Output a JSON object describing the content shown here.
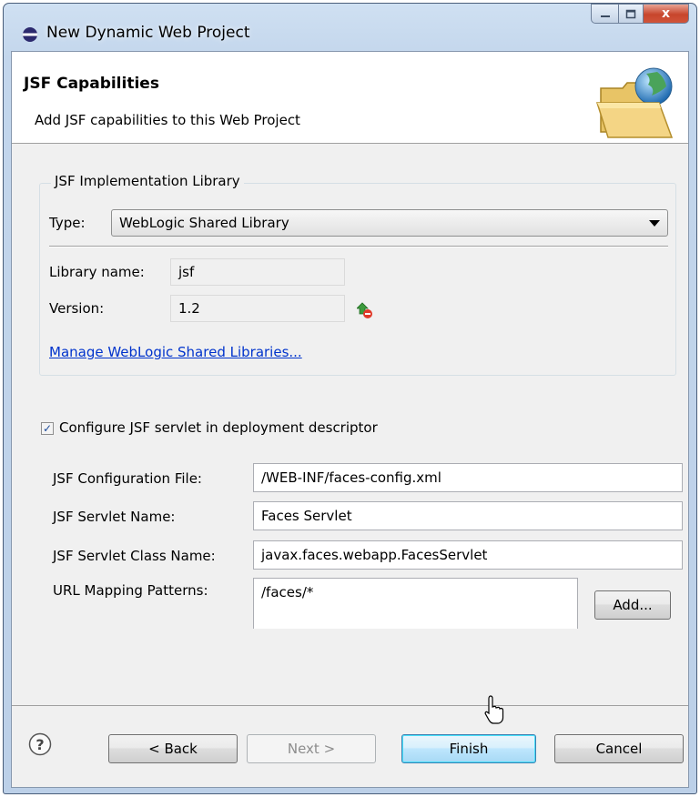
{
  "window": {
    "title": "New Dynamic Web Project",
    "close_glyph": "x"
  },
  "header": {
    "title": "JSF Capabilities",
    "description": "Add JSF capabilities to this Web Project",
    "icon": "folder-globe-icon"
  },
  "library_group": {
    "legend": "JSF Implementation Library",
    "type_label": "Type:",
    "type_value": "WebLogic Shared Library",
    "library_name_label": "Library name:",
    "library_name_value": "jsf",
    "version_label": "Version:",
    "version_value": "1.2",
    "manage_link": "Manage WebLogic Shared Libraries..."
  },
  "servlet": {
    "checkbox_label": "Configure JSF servlet in deployment descriptor",
    "checked": true,
    "config_file_label": "JSF Configuration File:",
    "config_file_value": "/WEB-INF/faces-config.xml",
    "servlet_name_label": "JSF Servlet Name:",
    "servlet_name_value": "Faces Servlet",
    "servlet_class_label": "JSF Servlet Class Name:",
    "servlet_class_value": "javax.faces.webapp.FacesServlet",
    "url_patterns_label": "URL Mapping Patterns:",
    "url_patterns": [
      "/faces/*"
    ],
    "add_label": "Add..."
  },
  "footer": {
    "help": "?",
    "back_label": "< Back",
    "next_label": "Next >",
    "finish_label": "Finish",
    "cancel_label": "Cancel"
  },
  "colors": {
    "link": "#0033cc",
    "default_button_border": "#3c7fb1",
    "close_button": "#c7452c"
  }
}
